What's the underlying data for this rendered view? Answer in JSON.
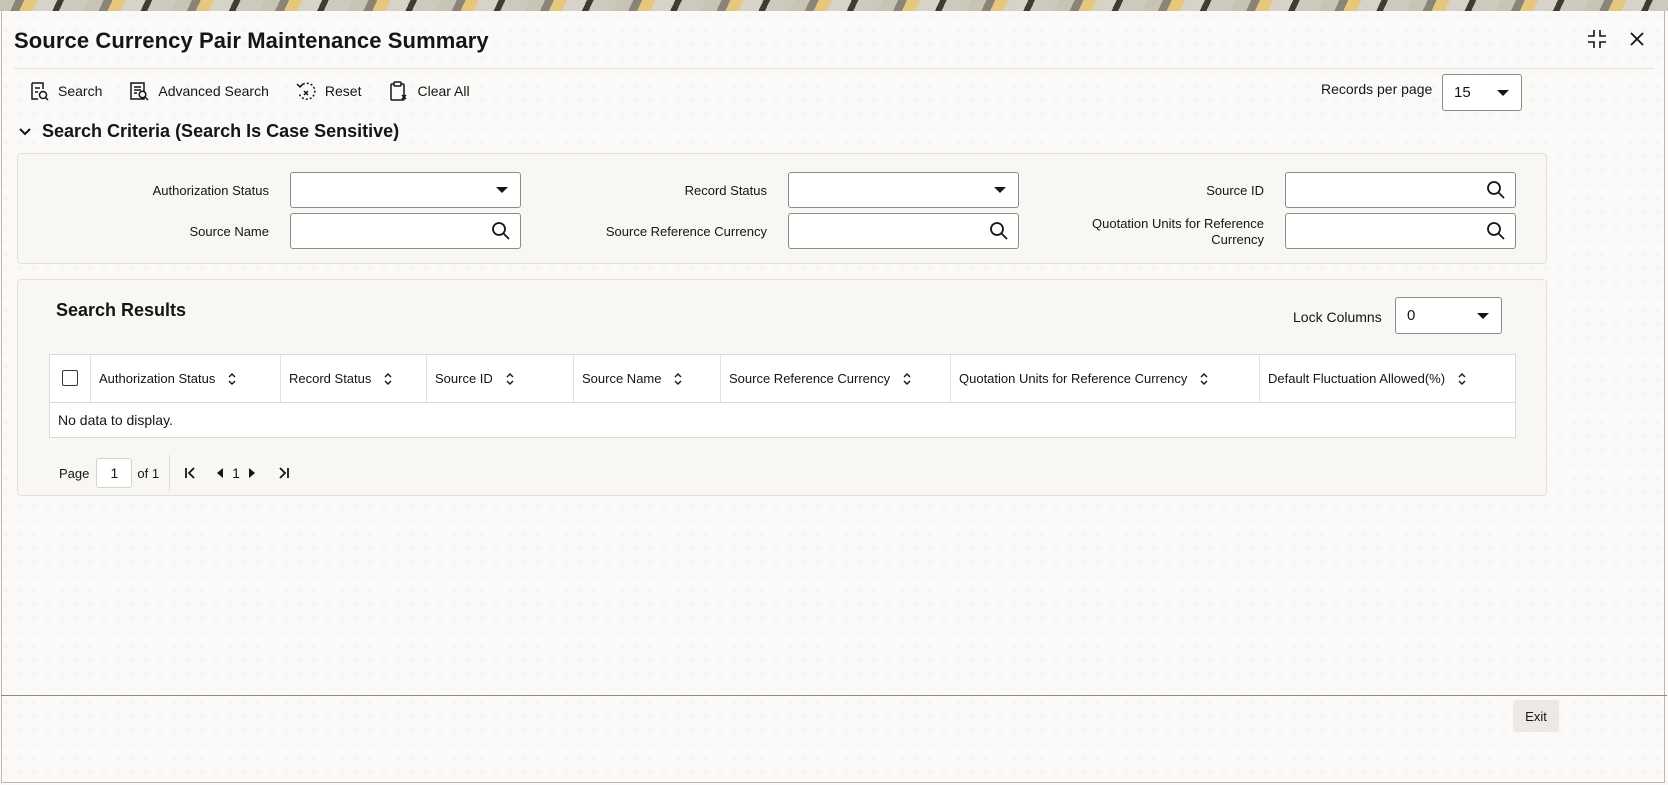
{
  "window": {
    "title": "Source Currency Pair Maintenance Summary"
  },
  "toolbar": {
    "search_label": "Search",
    "advanced_search_label": "Advanced Search",
    "reset_label": "Reset",
    "clear_all_label": "Clear All"
  },
  "records_per_page": {
    "label": "Records per page",
    "value": "15"
  },
  "search_criteria": {
    "title": "Search Criteria (Search Is Case Sensitive)",
    "fields": {
      "authorization_status": {
        "label": "Authorization Status",
        "value": ""
      },
      "record_status": {
        "label": "Record Status",
        "value": ""
      },
      "source_id": {
        "label": "Source ID",
        "value": ""
      },
      "source_name": {
        "label": "Source Name",
        "value": ""
      },
      "source_reference_currency": {
        "label": "Source Reference Currency",
        "value": ""
      },
      "quotation_units": {
        "label": "Quotation Units for Reference Currency",
        "value": ""
      }
    }
  },
  "search_results": {
    "title": "Search Results",
    "lock_columns": {
      "label": "Lock Columns",
      "value": "0"
    },
    "columns": [
      "Authorization Status",
      "Record Status",
      "Source ID",
      "Source Name",
      "Source Reference Currency",
      "Quotation Units for Reference Currency",
      "Default Fluctuation Allowed(%)"
    ],
    "empty_message": "No data to display."
  },
  "pagination": {
    "page_label": "Page",
    "current_page": "1",
    "of_label": "of 1",
    "page_number": "1"
  },
  "footer": {
    "exit_label": "Exit"
  }
}
